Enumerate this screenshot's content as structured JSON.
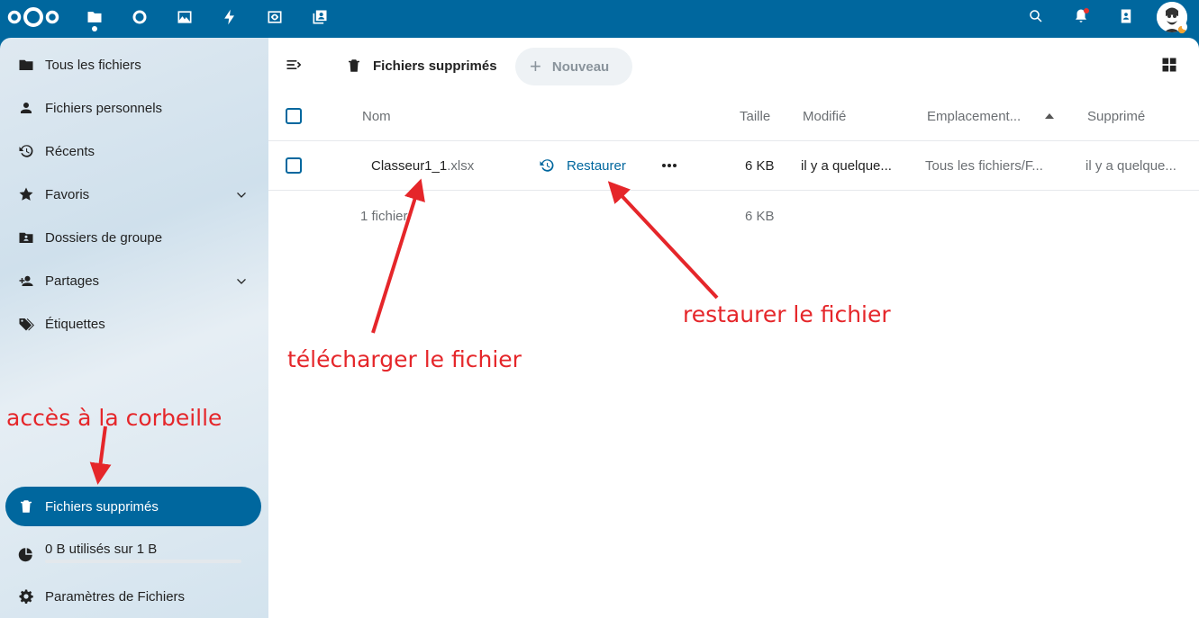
{
  "header": {
    "apps": [
      {
        "name": "files",
        "icon": "folder-icon"
      },
      {
        "name": "activity",
        "icon": "circle-icon"
      },
      {
        "name": "photos",
        "icon": "image-icon"
      },
      {
        "name": "flow",
        "icon": "bolt-icon"
      },
      {
        "name": "talk",
        "icon": "eye-icon"
      },
      {
        "name": "contacts",
        "icon": "contacts-icon"
      }
    ],
    "right_icons": [
      "search-icon",
      "bell-icon",
      "contacts-menu-icon"
    ]
  },
  "sidebar": {
    "items": [
      {
        "label": "Tous les fichiers",
        "icon": "folder-icon"
      },
      {
        "label": "Fichiers personnels",
        "icon": "person-icon"
      },
      {
        "label": "Récents",
        "icon": "history-icon"
      },
      {
        "label": "Favoris",
        "icon": "star-icon"
      },
      {
        "label": "Dossiers de groupe",
        "icon": "group-folder-icon"
      },
      {
        "label": "Partages",
        "icon": "share-icon"
      },
      {
        "label": "Étiquettes",
        "icon": "tag-icon"
      }
    ],
    "trash": {
      "label": "Fichiers supprimés",
      "icon": "trash-icon"
    },
    "quota": {
      "label": "0 B utilisés sur 1 B",
      "fraction": 0
    },
    "settings": {
      "label": "Paramètres de Fichiers",
      "icon": "gear-icon"
    }
  },
  "main": {
    "breadcrumb": "Fichiers supprimés",
    "new_button": "Nouveau",
    "columns": {
      "name": "Nom",
      "size": "Taille",
      "modified": "Modifié",
      "location": "Emplacement...",
      "deleted": "Supprimé"
    },
    "rows": [
      {
        "name": "Classeur1_1",
        "ext": ".xlsx",
        "action": "Restaurer",
        "size": "6 KB",
        "modified": "il y a quelque...",
        "location": "Tous les fichiers/F...",
        "deleted": "il y a quelque..."
      }
    ],
    "summary": {
      "count": "1 fichier",
      "size": "6 KB"
    }
  },
  "annotations": {
    "download": "télécharger le fichier",
    "restore": "restaurer le fichier",
    "trash_access": "accès à la corbeille"
  },
  "colors": {
    "brand": "#00679e",
    "annotation": "#e5262a"
  }
}
